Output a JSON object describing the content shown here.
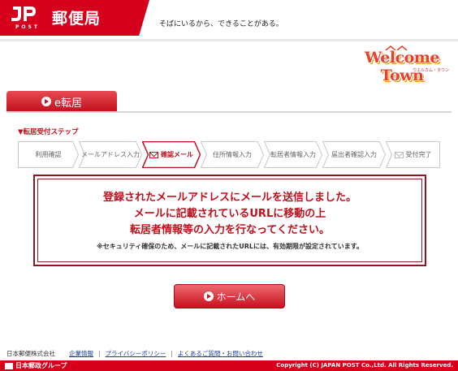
{
  "header": {
    "jp_post_label": "POST",
    "brand_name": "郵便局",
    "tagline": "そばにいるから、できることがある。"
  },
  "welcome_logo": {
    "title": "Welcome Town",
    "subtitle": "ウエルカム・タウン"
  },
  "service_tab": {
    "label": "e転居"
  },
  "steps": {
    "title": "▼転居受付ステップ",
    "items": [
      {
        "label": "利用確認",
        "state": "done"
      },
      {
        "label": "メールアドレス入力",
        "state": "done"
      },
      {
        "label": "確認メール",
        "state": "active",
        "icon": "mail-icon"
      },
      {
        "label": "住所情報入力",
        "state": "todo"
      },
      {
        "label": "転居者情報入力",
        "state": "todo"
      },
      {
        "label": "届出者確認入力",
        "state": "todo"
      },
      {
        "label": "受付完了",
        "state": "todo",
        "icon": "mail-icon"
      }
    ]
  },
  "message": {
    "line1": "登録されたメールアドレスにメールを送信しました。",
    "line2": "メールに記載されているURLに移動の上",
    "line3": "転居者情報等の入力を行なってください。",
    "note": "※セキュリティ確保のため、メールに記載されたURLには、有効期限が設定されています。"
  },
  "home_button": {
    "label": "ホームへ"
  },
  "footer": {
    "company": "日本郵便株式会社",
    "links": [
      "企業情報",
      "プライバシーポリシー",
      "よくあるご質問・お問い合わせ"
    ],
    "group_logo": "日本郵政グループ",
    "copyright": "Copyright (C) JAPAN POST Co.,Ltd. All Rights Reserved."
  },
  "colors": {
    "brand_red": "#d6001c",
    "message_red": "#c0101c",
    "border_dark_red": "#8a1820",
    "link_blue": "#1a3c9a"
  }
}
